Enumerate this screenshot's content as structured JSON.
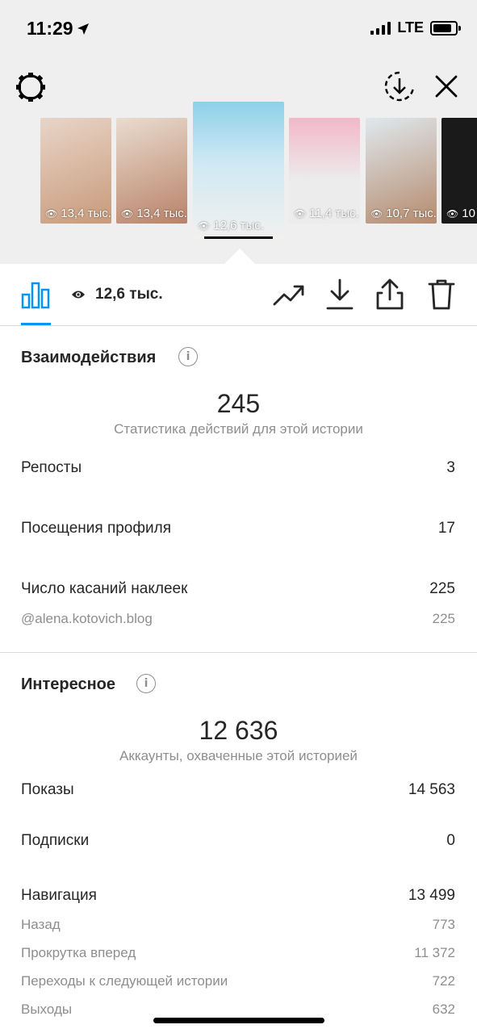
{
  "status_bar": {
    "time": "11:29",
    "network": "LTE"
  },
  "stories": [
    {
      "views": "13,4 тыс.",
      "colors": [
        "#e8d5c8",
        "#c89a7a"
      ]
    },
    {
      "views": "13,4 тыс.",
      "colors": [
        "#e9dccf",
        "#b98268"
      ]
    },
    {
      "views": "12,6 тыс.",
      "colors": [
        "#8fd0ea",
        "#f1f1ee"
      ],
      "active": true
    },
    {
      "views": "11,4 тыс.",
      "colors": [
        "#f3b7c8",
        "#ececec"
      ]
    },
    {
      "views": "10,7 тыс.",
      "colors": [
        "#dfe8ee",
        "#b58b6d"
      ]
    },
    {
      "views": "10",
      "colors": [
        "#1a1a1a",
        "#2a2a2a"
      ]
    }
  ],
  "toolbar": {
    "views": "12,6 тыс."
  },
  "interactions": {
    "title": "Взаимодействия",
    "total": "245",
    "subtitle": "Статистика действий для этой истории",
    "rows": [
      {
        "label": "Репосты",
        "value": "3"
      },
      {
        "label": "Посещения профиля",
        "value": "17"
      },
      {
        "label": "Число касаний наклеек",
        "value": "225"
      }
    ],
    "sub_rows": [
      {
        "label": "@alena.kotovich.blog",
        "value": "225"
      }
    ]
  },
  "discovery": {
    "title": "Интересное",
    "total": "12 636",
    "subtitle": "Аккаунты, охваченные этой историей",
    "rows": [
      {
        "label": "Показы",
        "value": "14 563"
      },
      {
        "label": "Подписки",
        "value": "0"
      },
      {
        "label": "Навигация",
        "value": "13 499"
      }
    ],
    "sub_rows": [
      {
        "label": "Назад",
        "value": "773"
      },
      {
        "label": "Прокрутка вперед",
        "value": "11 372"
      },
      {
        "label": "Переходы к следующей истории",
        "value": "722"
      },
      {
        "label": "Выходы",
        "value": "632"
      }
    ]
  },
  "colors": {
    "accent": "#0095f6",
    "text": "#262626",
    "muted": "#8e8e8e",
    "divider": "#dbdbdb"
  }
}
